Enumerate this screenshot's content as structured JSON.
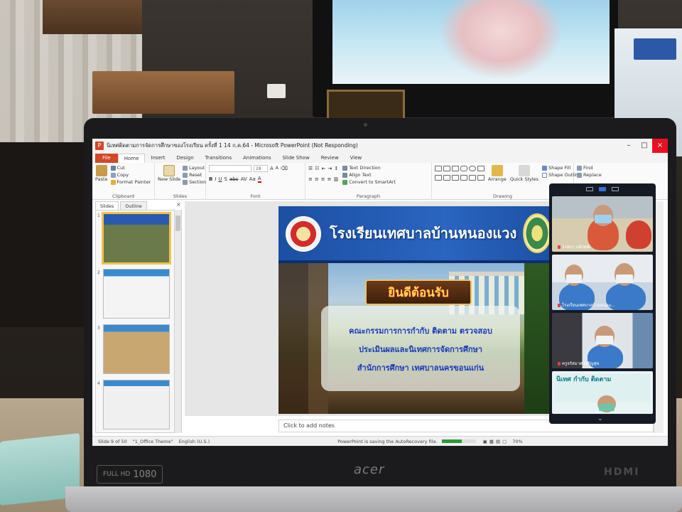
{
  "window": {
    "title": "นิเทศติดตามการจัดการศึกษาของโรงเรียน ครั้งที่ 1 14 ก.ค.64 - Microsoft PowerPoint (Not Responding)",
    "app_icon_letter": "P"
  },
  "ribbon_tabs": [
    "File",
    "Home",
    "Insert",
    "Design",
    "Transitions",
    "Animations",
    "Slide Show",
    "Review",
    "View"
  ],
  "ribbon": {
    "clipboard": {
      "paste": "Paste",
      "cut": "Cut",
      "copy": "Copy",
      "format_painter": "Format Painter",
      "label": "Clipboard"
    },
    "slides": {
      "new_slide": "New Slide",
      "layout": "Layout",
      "reset": "Reset",
      "section": "Section",
      "label": "Slides"
    },
    "font": {
      "size": "28",
      "label": "Font"
    },
    "paragraph": {
      "text_direction": "Text Direction",
      "align_text": "Align Text",
      "convert_smartart": "Convert to SmartArt",
      "label": "Paragraph"
    },
    "drawing": {
      "arrange": "Arrange",
      "quick_styles": "Quick Styles",
      "shape_fill": "Shape Fill",
      "shape_outline": "Shape Outline",
      "label": "Drawing"
    },
    "editing": {
      "find": "Find",
      "replace": "Replace"
    }
  },
  "slides_pane": {
    "tabs": [
      "Slides",
      "Outline"
    ],
    "thumb_numbers": [
      "1",
      "2",
      "3",
      "4"
    ]
  },
  "slide": {
    "school_name": "โรงเรียนเทศบาลบ้านหนองแวง",
    "welcome": "ยินดีต้อนรับ",
    "lines": [
      "คณะกรรมการการกำกับ ติดตาม ตรวจสอบ",
      "ประเมินผลและนิเทศการจัดการศึกษา",
      "สำนักการศึกษา เทศบาลนครขอนแก่น"
    ]
  },
  "notes_placeholder": "Click to add notes",
  "status": {
    "slide_count": "Slide 9 of 50",
    "theme": "\"1_Office Theme\"",
    "language": "English (U.S.)",
    "saving": "PowerPoint is saving the AutoRecovery file.",
    "zoom": "70%",
    "progress": 0.6
  },
  "call": {
    "participants": [
      {
        "name": "วาสนา แผ้วพุฒิ"
      },
      {
        "name": "โรงเรียนเทศบาลบ้านหนอง..."
      },
      {
        "name": "ครูจรัสมาศ เจริญสุข"
      },
      {
        "name": ""
      }
    ],
    "tile4_title": "นิเทศ กำกับ ติดตาม"
  },
  "laptop": {
    "brand": "acer",
    "hd": "1080",
    "hd_prefix": "FULL HD",
    "port": "HDMI"
  },
  "colors": {
    "ppt_accent": "#d24726",
    "slide_blue": "#1c4fa3",
    "welcome_gold": "#ffd84a",
    "committee_text": "#1a3ab8"
  }
}
